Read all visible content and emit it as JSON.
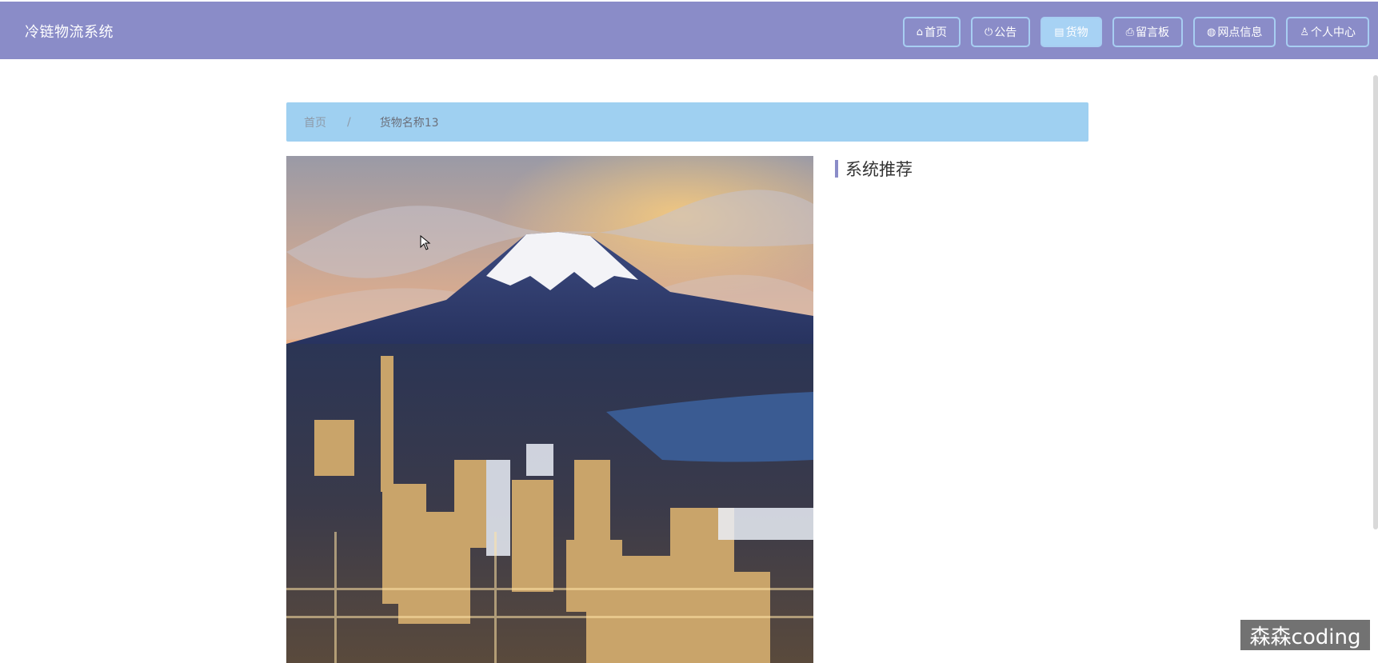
{
  "header": {
    "title": "冷链物流系统",
    "nav": [
      {
        "label": "首页",
        "icon": "home-icon",
        "glyph": "⌂"
      },
      {
        "label": "公告",
        "icon": "power-icon",
        "glyph": "⏻"
      },
      {
        "label": "货物",
        "icon": "goods-icon",
        "glyph": "▤"
      },
      {
        "label": "留言板",
        "icon": "printer-icon",
        "glyph": "⎙"
      },
      {
        "label": "网点信息",
        "icon": "globe-icon",
        "glyph": "◍"
      },
      {
        "label": "个人中心",
        "icon": "user-icon",
        "glyph": "♙"
      }
    ],
    "active": "货物"
  },
  "breadcrumb": {
    "home": "首页",
    "separator": "/",
    "current": "货物名称13"
  },
  "recommend": {
    "title": "系统推荐"
  },
  "watermark": "森森coding",
  "colors": {
    "header_bg": "#8a8cc8",
    "nav_border": "#a7cef2",
    "nav_active_bg": "#a7d2f4",
    "breadcrumb_bg": "#9fd0f1"
  }
}
